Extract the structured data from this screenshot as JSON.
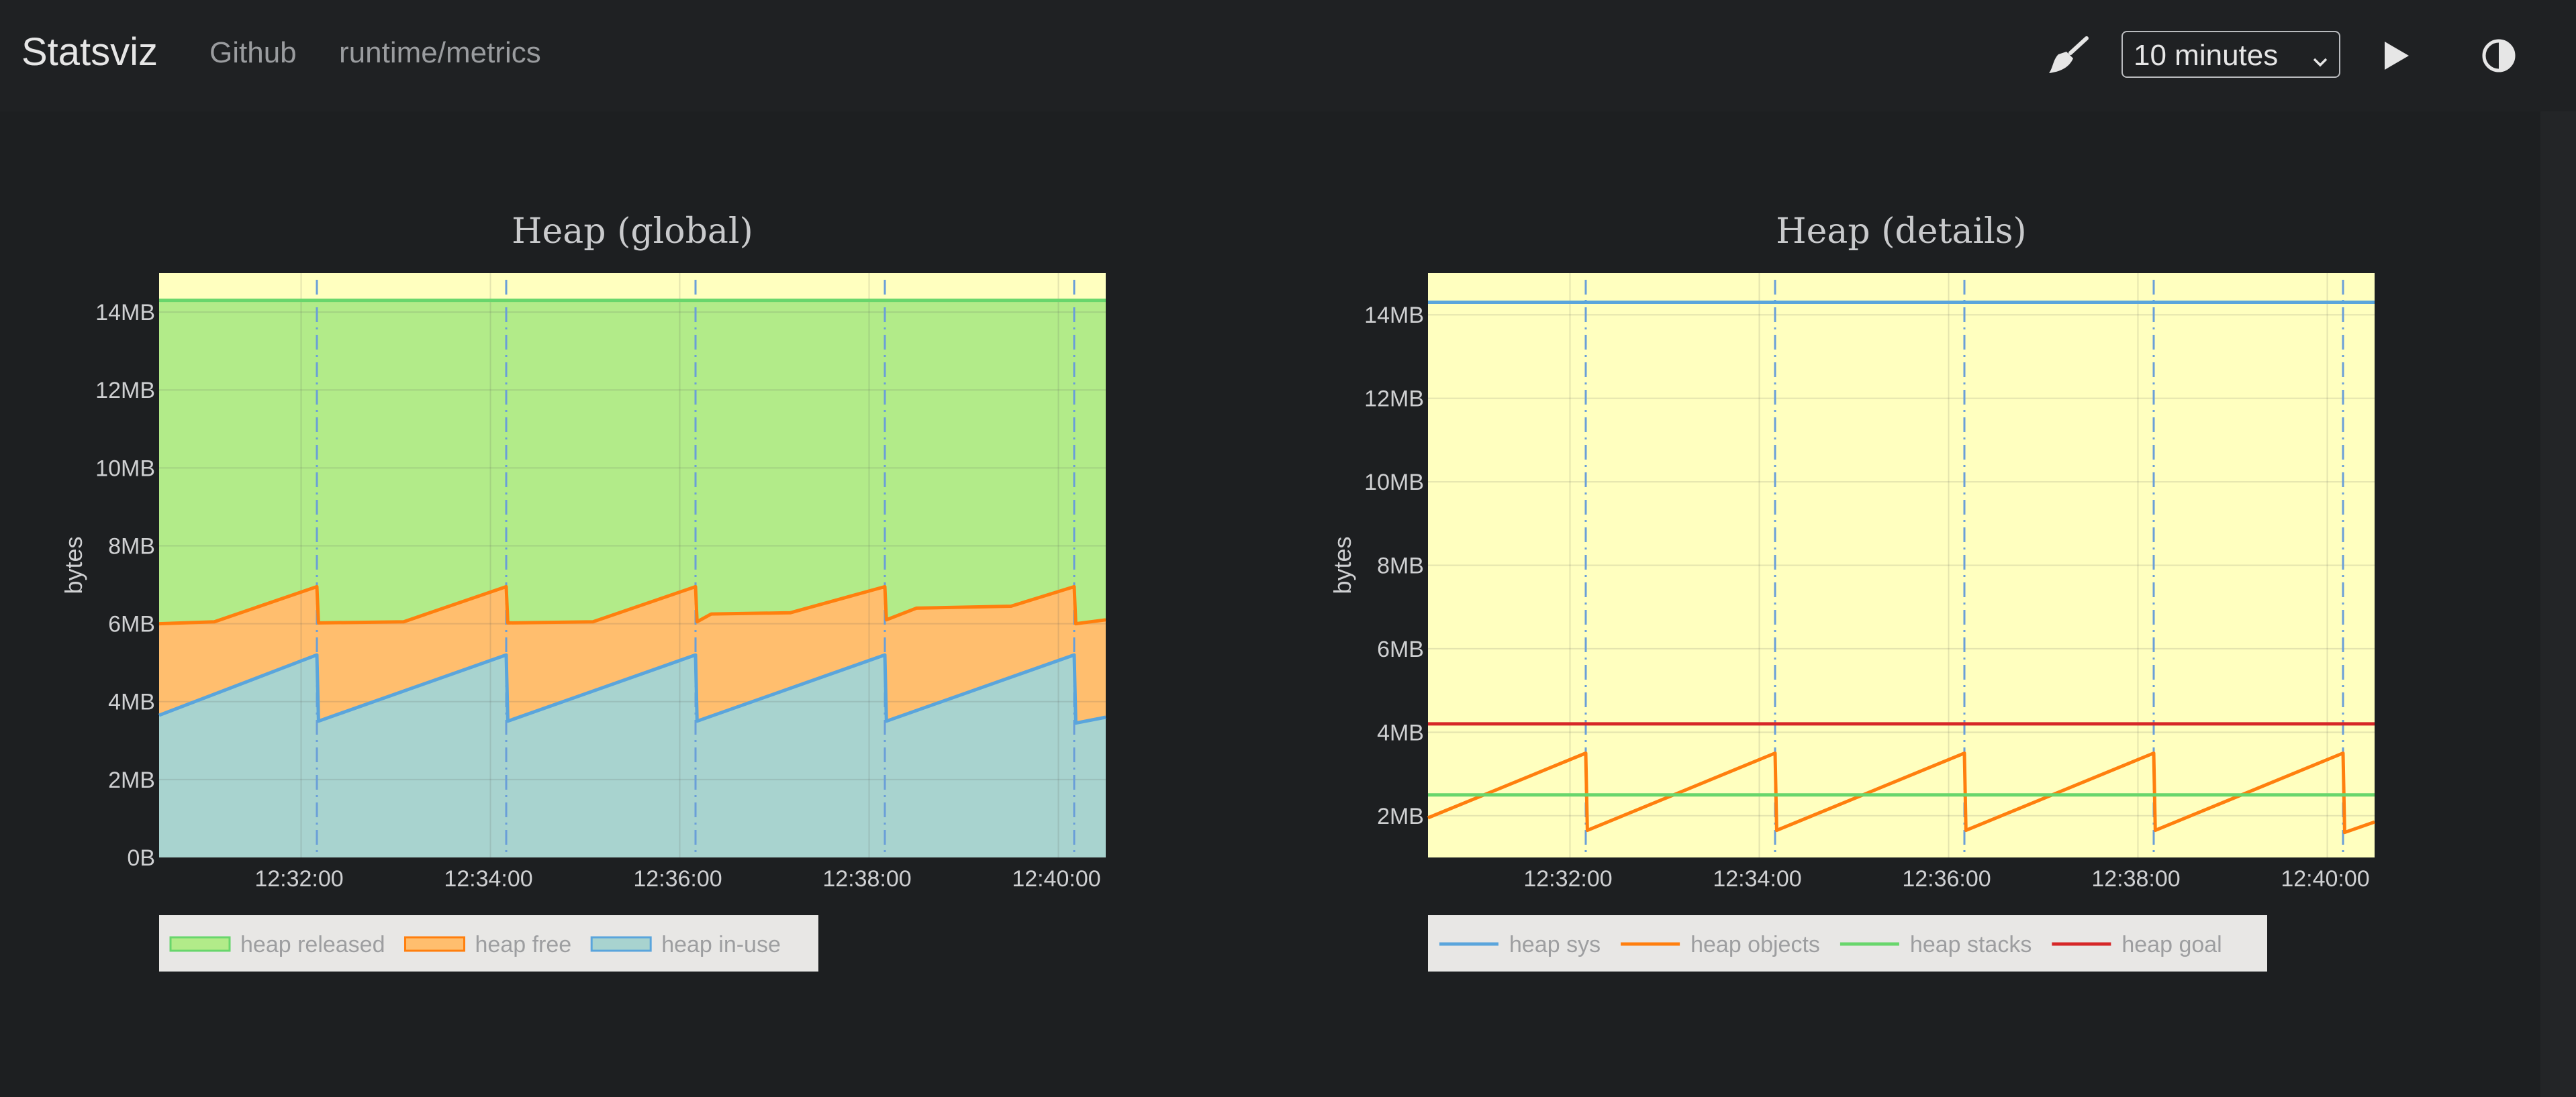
{
  "nav": {
    "brand": "Statsviz",
    "links": [
      "Github",
      "runtime/metrics"
    ],
    "time_range": "10 minutes",
    "icons": [
      "broom-icon",
      "play-icon",
      "contrast-icon"
    ]
  },
  "chart_data": [
    {
      "type": "area",
      "title": "Heap (global)",
      "ylabel": "bytes",
      "yticks": [
        "0B",
        "2MB",
        "4MB",
        "6MB",
        "8MB",
        "10MB",
        "12MB",
        "14MB"
      ],
      "xticks": [
        "12:32:00",
        "12:34:00",
        "12:36:00",
        "12:38:00",
        "12:40:00"
      ],
      "xrange": [
        "12:30:30",
        "12:40:30"
      ],
      "ylim_mb": [
        0,
        15
      ],
      "stacked": true,
      "gc_events": [
        "12:32:10",
        "12:34:10",
        "12:36:10",
        "12:38:10",
        "12:40:10"
      ],
      "background": "#ffffbf",
      "grid": true,
      "legend_position": "bottom-left",
      "series": [
        {
          "name": "heap released",
          "color": "#68d66c",
          "fill": "#b2eb89",
          "stack_top_mb": 14.3
        },
        {
          "name": "heap free",
          "color": "#ff7f0e",
          "fill": "#ffbe6e",
          "stack_top_points": [
            [
              "12:30:30",
              6.0
            ],
            [
              "12:31:05",
              6.05
            ],
            [
              "12:32:10",
              6.95
            ],
            [
              "12:32:11",
              6.02
            ],
            [
              "12:33:05",
              6.05
            ],
            [
              "12:34:10",
              6.95
            ],
            [
              "12:34:11",
              6.02
            ],
            [
              "12:35:05",
              6.05
            ],
            [
              "12:36:10",
              6.95
            ],
            [
              "12:36:11",
              6.05
            ],
            [
              "12:36:20",
              6.25
            ],
            [
              "12:37:10",
              6.28
            ],
            [
              "12:38:10",
              6.95
            ],
            [
              "12:38:11",
              6.1
            ],
            [
              "12:38:30",
              6.4
            ],
            [
              "12:39:30",
              6.45
            ],
            [
              "12:40:10",
              6.95
            ],
            [
              "12:40:11",
              6.0
            ],
            [
              "12:40:30",
              6.1
            ]
          ]
        },
        {
          "name": "heap in-use",
          "color": "#5aa5dc",
          "fill": "#a8d3cf",
          "points": [
            [
              "12:30:30",
              3.65
            ],
            [
              "12:32:10",
              5.2
            ],
            [
              "12:32:11",
              3.5
            ],
            [
              "12:34:10",
              5.2
            ],
            [
              "12:34:11",
              3.5
            ],
            [
              "12:36:10",
              5.2
            ],
            [
              "12:36:11",
              3.5
            ],
            [
              "12:38:10",
              5.2
            ],
            [
              "12:38:11",
              3.5
            ],
            [
              "12:40:10",
              5.2
            ],
            [
              "12:40:11",
              3.45
            ],
            [
              "12:40:30",
              3.6
            ]
          ]
        }
      ]
    },
    {
      "type": "line",
      "title": "Heap (details)",
      "ylabel": "bytes",
      "yticks": [
        "2MB",
        "4MB",
        "6MB",
        "8MB",
        "10MB",
        "12MB",
        "14MB"
      ],
      "xticks": [
        "12:32:00",
        "12:34:00",
        "12:36:00",
        "12:38:00",
        "12:40:00"
      ],
      "xrange": [
        "12:30:30",
        "12:40:30"
      ],
      "ylim_mb": [
        1,
        15
      ],
      "gc_events": [
        "12:32:10",
        "12:34:10",
        "12:36:10",
        "12:38:10",
        "12:40:10"
      ],
      "background": "#ffffbf",
      "grid": true,
      "legend_position": "bottom-left",
      "series": [
        {
          "name": "heap sys",
          "color": "#5aa5dc",
          "points": [
            [
              "12:30:30",
              14.3
            ],
            [
              "12:40:30",
              14.3
            ]
          ]
        },
        {
          "name": "heap objects",
          "color": "#ff7f0e",
          "points": [
            [
              "12:30:30",
              1.95
            ],
            [
              "12:32:10",
              3.5
            ],
            [
              "12:32:11",
              1.65
            ],
            [
              "12:34:10",
              3.5
            ],
            [
              "12:34:11",
              1.65
            ],
            [
              "12:36:10",
              3.5
            ],
            [
              "12:36:11",
              1.65
            ],
            [
              "12:38:10",
              3.5
            ],
            [
              "12:38:11",
              1.65
            ],
            [
              "12:40:10",
              3.5
            ],
            [
              "12:40:11",
              1.6
            ],
            [
              "12:40:30",
              1.85
            ]
          ]
        },
        {
          "name": "heap stacks",
          "color": "#68d66c",
          "points": [
            [
              "12:30:30",
              2.5
            ],
            [
              "12:40:30",
              2.5
            ]
          ]
        },
        {
          "name": "heap goal",
          "color": "#d62728",
          "points": [
            [
              "12:30:30",
              4.2
            ],
            [
              "12:40:30",
              4.2
            ]
          ]
        }
      ]
    }
  ]
}
